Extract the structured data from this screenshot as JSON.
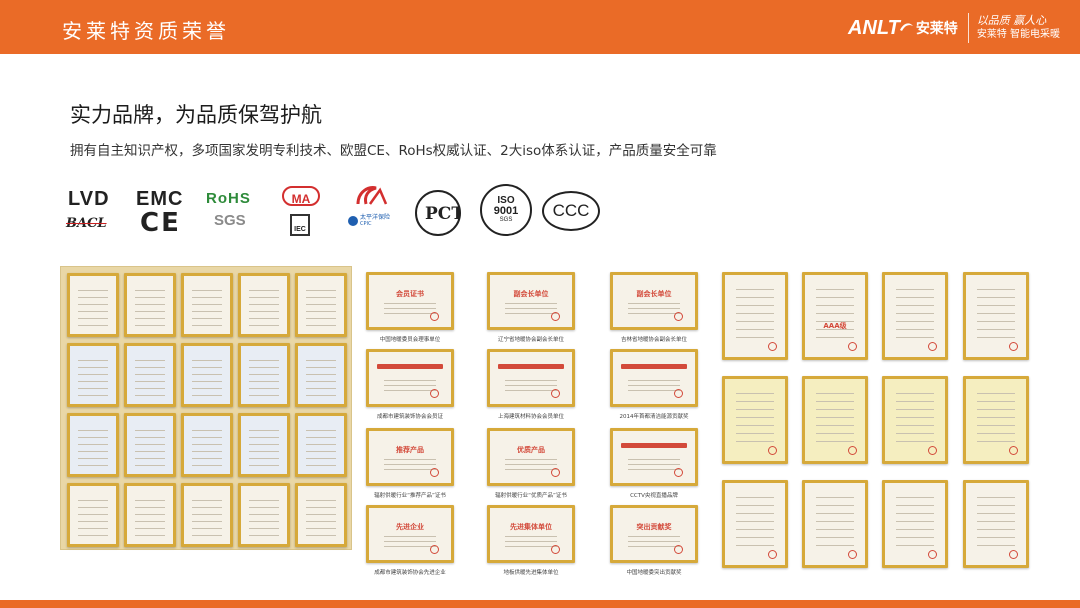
{
  "header": {
    "title": "安莱特资质荣誉",
    "brand_logo": "ANLT",
    "brand_cn": "安莱特",
    "slogan": "以品质 赢人心",
    "brand_tagline_a": "安莱特",
    "brand_tagline_b": "智能电采暖"
  },
  "intro": {
    "heading": "实力品牌，为品质保驾护航",
    "text": "拥有自主知识产权，多项国家发明专利技术、欧盟CE、RoHs权威认证、2大iso体系认证，产品质量安全可靠"
  },
  "logos": {
    "lvd": "LVD",
    "bacl": "BACL",
    "emc": "EMC",
    "ce": "CE",
    "rohs": "RoHS",
    "sgs": "SGS",
    "ma": "MA",
    "iec": "IEC",
    "cpic_cn": "太平洋保险",
    "cpic_en": "CPIC",
    "pct": "PCT",
    "iso": "ISO",
    "iso_num": "9001",
    "iso_sub": "SGS",
    "ccc": "CCC"
  },
  "colors": {
    "accent": "#ea6b27",
    "gold_frame": "#d6a93a",
    "cert_red": "#d34a3a"
  },
  "certificates": {
    "captions": [
      "中国地暖委员会理事单位",
      "辽宁省地暖协会副会长单位",
      "吉林省地暖协会副会长单位",
      "成都市建筑装饰协会会员证",
      "上海建筑材料协会会员单位",
      "2014年首都清洁能源贡献奖",
      "辐射供暖行业“推荐产品”证书",
      "辐射供暖行业“优质产品”证书",
      "CCTV央视直播品牌",
      "成都市建筑装饰协会先进企业",
      "地板供暖先进集体单位",
      "中国地暖委突出贡献奖"
    ],
    "titles": [
      "会员证书",
      "副会长单位",
      "副会长单位",
      "推荐产品",
      "优质产品",
      "先进企业",
      "先进集体单位",
      "突出贡献奖",
      "AAA级"
    ]
  }
}
